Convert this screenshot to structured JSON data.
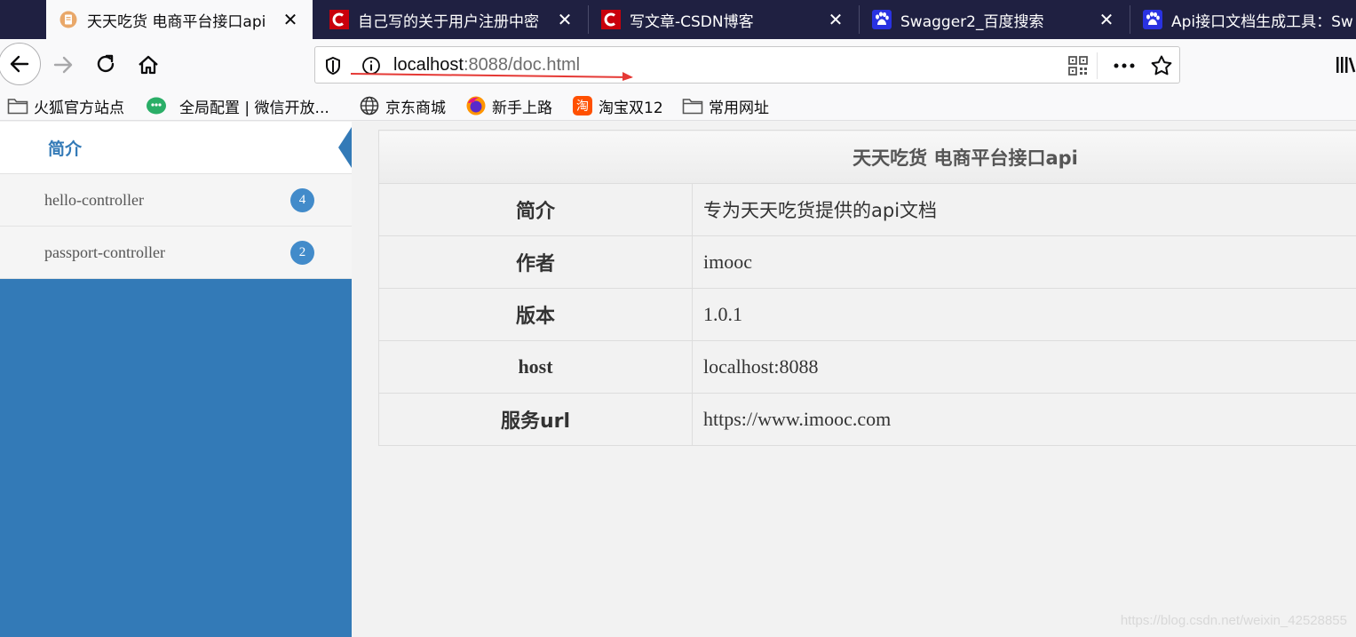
{
  "tabs": [
    {
      "title": "天天吃货 电商平台接口api",
      "close": "✕",
      "icon": "document-icon"
    },
    {
      "title": "自己写的关于用户注册中密",
      "close": "✕",
      "icon": "csdn-icon"
    },
    {
      "title": "写文章-CSDN博客",
      "close": "✕",
      "icon": "csdn-icon"
    },
    {
      "title": "Swagger2_百度搜索",
      "close": "✕",
      "icon": "baidu-icon"
    },
    {
      "title": "Api接口文档生成工具：Sw",
      "close": "",
      "icon": "baidu-icon"
    }
  ],
  "address": {
    "host": "localhost",
    "rest": ":8088/doc.html"
  },
  "bookmarks": [
    {
      "label": "火狐官方站点",
      "icon": "folder-icon"
    },
    {
      "label": "全局配置 | 微信开放...",
      "icon": "wechat-icon"
    },
    {
      "label": "京东商城",
      "icon": "globe-icon"
    },
    {
      "label": "新手上路",
      "icon": "firefox-icon"
    },
    {
      "label": "淘宝双12",
      "icon": "taobao-icon"
    },
    {
      "label": "常用网址",
      "icon": "folder-icon"
    }
  ],
  "sidebar": {
    "items": [
      {
        "label": "简介"
      },
      {
        "label": "hello-controller",
        "count": "4"
      },
      {
        "label": "passport-controller",
        "count": "2"
      }
    ]
  },
  "doc": {
    "title": "天天吃货 电商平台接口api",
    "rows": [
      {
        "key": "简介",
        "value": "专为天天吃货提供的api文档"
      },
      {
        "key": "作者",
        "value": "imooc"
      },
      {
        "key": "版本",
        "value": "1.0.1"
      },
      {
        "key": "host",
        "value": "localhost:8088"
      },
      {
        "key": "服务url",
        "value": "https://www.imooc.com"
      }
    ]
  },
  "watermark": "https://blog.csdn.net/weixin_42528855",
  "colors": {
    "sidebar": "#337ab7",
    "badge": "#428bca",
    "tabbar": "#1f2041",
    "annotation": "#e53935"
  }
}
